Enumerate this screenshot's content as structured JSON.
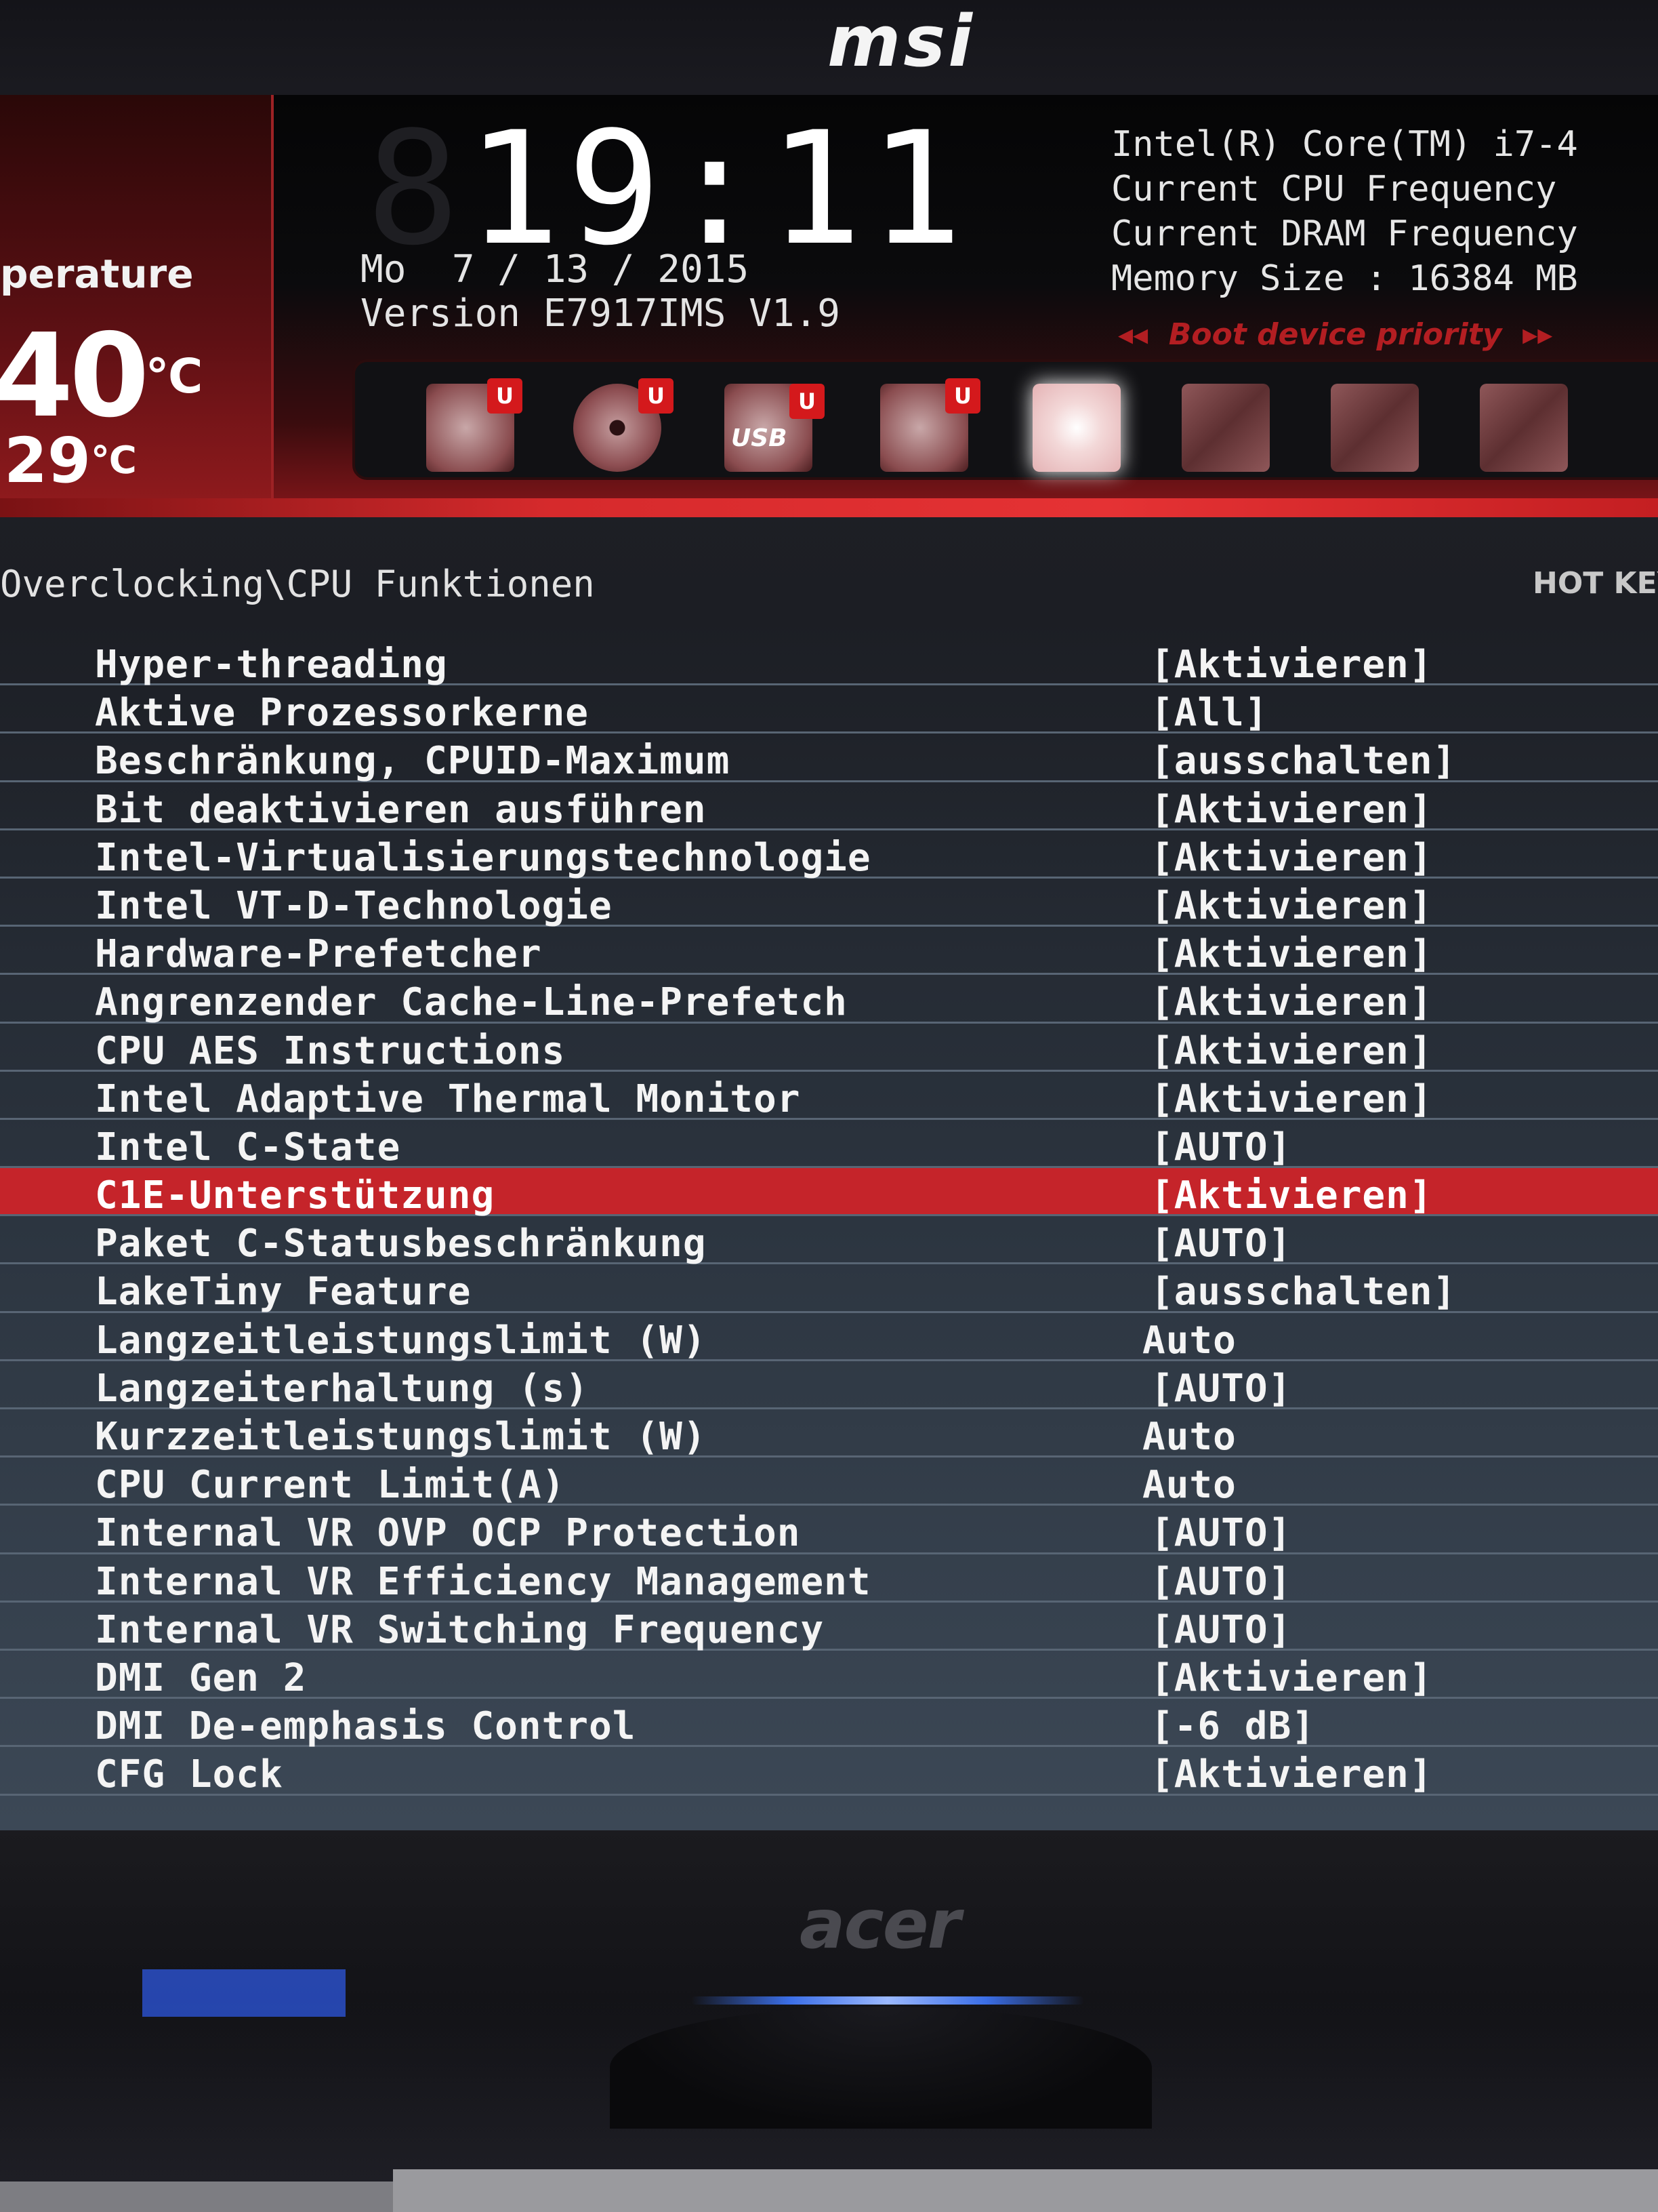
{
  "bezel": {
    "brand_logo": "msi",
    "monitor_logo": "acer"
  },
  "header": {
    "temperature_label": "perature",
    "cpu_temp": "40",
    "cpu_temp_unit": "℃",
    "mb_temp": "29",
    "mb_temp_unit": "℃",
    "clock": {
      "hours": "19",
      "separator": ":",
      "minutes": "11"
    },
    "date": "Mo  7 / 13 / 2015",
    "version": "Version E7917IMS V1.9"
  },
  "system_info": {
    "cpu": "Intel(R) Core(TM) i7-4",
    "cpu_frequency": "Current CPU Frequency",
    "dram_frequency": "Current DRAM Frequency",
    "memory_size": "Memory Size : 16384 MB"
  },
  "boot": {
    "priority_label": "◂◂  Boot device priority  ▸▸",
    "uefi_badge": "U",
    "usb_label": "USB",
    "devices": [
      {
        "type": "hdd",
        "icon": "hard-disk-icon",
        "uefi": true
      },
      {
        "type": "cd",
        "icon": "optical-disc-icon",
        "uefi": true
      },
      {
        "type": "usb",
        "icon": "usb-drive-icon",
        "uefi": true
      },
      {
        "type": "net",
        "icon": "network-drive-icon",
        "uefi": true
      },
      {
        "type": "active",
        "icon": "hard-disk-icon",
        "uefi": false
      },
      {
        "type": "empty",
        "icon": "empty-slot-icon",
        "uefi": false
      },
      {
        "type": "empty",
        "icon": "empty-slot-icon",
        "uefi": false
      },
      {
        "type": "empty",
        "icon": "empty-slot-icon",
        "uefi": false
      }
    ]
  },
  "breadcrumb": "Overclocking\\CPU Funktionen",
  "hotkey_label": "HOT KEY",
  "selected_index": 11,
  "settings": [
    {
      "name": "Hyper-threading",
      "value": "[Aktivieren]"
    },
    {
      "name": "Aktive Prozessorkerne",
      "value": "[All]"
    },
    {
      "name": "Beschränkung, CPUID-Maximum",
      "value": "[ausschalten]"
    },
    {
      "name": "Bit deaktivieren ausführen",
      "value": "[Aktivieren]"
    },
    {
      "name": "Intel-Virtualisierungstechnologie",
      "value": "[Aktivieren]"
    },
    {
      "name": "Intel VT-D-Technologie",
      "value": "[Aktivieren]"
    },
    {
      "name": "Hardware-Prefetcher",
      "value": "[Aktivieren]"
    },
    {
      "name": "Angrenzender Cache-Line-Prefetch",
      "value": "[Aktivieren]"
    },
    {
      "name": "CPU AES Instructions",
      "value": "[Aktivieren]"
    },
    {
      "name": "Intel Adaptive Thermal Monitor",
      "value": "[Aktivieren]"
    },
    {
      "name": "Intel C-State",
      "value": "[AUTO]"
    },
    {
      "name": "C1E-Unterstützung",
      "value": "[Aktivieren]"
    },
    {
      "name": "Paket C-Statusbeschränkung",
      "value": "[AUTO]"
    },
    {
      "name": "LakeTiny Feature",
      "value": "[ausschalten]"
    },
    {
      "name": "Langzeitleistungslimit (W)",
      "value": "Auto"
    },
    {
      "name": "Langzeiterhaltung (s)",
      "value": "[AUTO]"
    },
    {
      "name": "Kurzzeitleistungslimit (W)",
      "value": "Auto"
    },
    {
      "name": "CPU Current Limit(A)",
      "value": "Auto"
    },
    {
      "name": "Internal VR OVP OCP Protection",
      "value": "[AUTO]"
    },
    {
      "name": "Internal VR Efficiency Management",
      "value": "[AUTO]"
    },
    {
      "name": "Internal VR Switching Frequency",
      "value": "[AUTO]"
    },
    {
      "name": "DMI Gen 2",
      "value": "[Aktivieren]"
    },
    {
      "name": "DMI De-emphasis Control",
      "value": "[-6 dB]"
    },
    {
      "name": "CFG Lock",
      "value": "[Aktivieren]"
    }
  ],
  "colors": {
    "accent_red": "#c5242a",
    "header_red": "#d62a2c",
    "text": "#f4f4f4"
  }
}
